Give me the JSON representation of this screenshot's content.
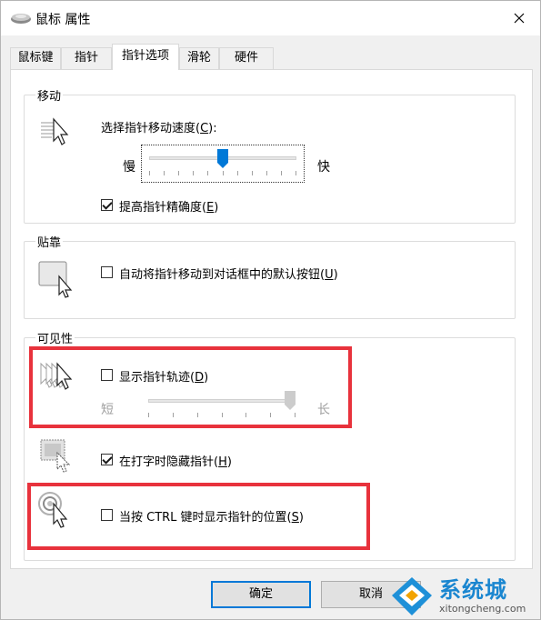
{
  "window": {
    "title": "鼠标 属性",
    "icon": "mouse-icon",
    "close_icon": "close-icon"
  },
  "tabs": [
    {
      "label": "鼠标键",
      "active": false
    },
    {
      "label": "指针",
      "active": false
    },
    {
      "label": "指针选项",
      "active": true
    },
    {
      "label": "滑轮",
      "active": false
    },
    {
      "label": "硬件",
      "active": false
    }
  ],
  "motion": {
    "title": "移动",
    "speed_label_prefix": "选择指针移动速度(",
    "speed_label_key": "C",
    "speed_label_suffix": "):",
    "slow": "慢",
    "fast": "快",
    "speed_value": 0.5,
    "precision_prefix": "提高指针精确度(",
    "precision_key": "E",
    "precision_suffix": ")",
    "precision_checked": true
  },
  "snap": {
    "title": "贴靠",
    "label_prefix": "自动将指针移动到对话框中的默认按钮(",
    "label_key": "U",
    "label_suffix": ")",
    "checked": false
  },
  "visibility": {
    "title": "可见性",
    "trails_prefix": "显示指针轨迹(",
    "trails_key": "D",
    "trails_suffix": ")",
    "trails_checked": false,
    "short": "短",
    "long": "长",
    "trails_value": 1.0,
    "hide_prefix": "在打字时隐藏指针(",
    "hide_key": "H",
    "hide_suffix": ")",
    "hide_checked": true,
    "ctrl_prefix": "当按 CTRL 键时显示指针的位置(",
    "ctrl_key": "S",
    "ctrl_suffix": ")",
    "ctrl_checked": false
  },
  "buttons": {
    "ok": "确定",
    "cancel": "取消"
  },
  "watermark": {
    "brand": "系统城",
    "url": "xitongcheng.com"
  },
  "colors": {
    "highlight_box": "#e8323c",
    "accent": "#0078d7"
  }
}
